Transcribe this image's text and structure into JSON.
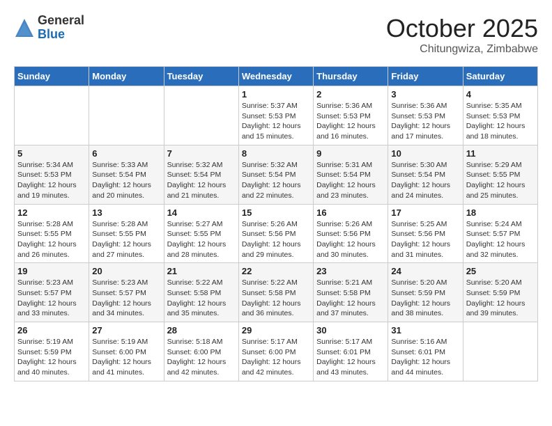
{
  "logo": {
    "general": "General",
    "blue": "Blue"
  },
  "title": "October 2025",
  "subtitle": "Chitungwiza, Zimbabwe",
  "weekdays": [
    "Sunday",
    "Monday",
    "Tuesday",
    "Wednesday",
    "Thursday",
    "Friday",
    "Saturday"
  ],
  "weeks": [
    [
      {
        "day": "",
        "info": ""
      },
      {
        "day": "",
        "info": ""
      },
      {
        "day": "",
        "info": ""
      },
      {
        "day": "1",
        "info": "Sunrise: 5:37 AM\nSunset: 5:53 PM\nDaylight: 12 hours\nand 15 minutes."
      },
      {
        "day": "2",
        "info": "Sunrise: 5:36 AM\nSunset: 5:53 PM\nDaylight: 12 hours\nand 16 minutes."
      },
      {
        "day": "3",
        "info": "Sunrise: 5:36 AM\nSunset: 5:53 PM\nDaylight: 12 hours\nand 17 minutes."
      },
      {
        "day": "4",
        "info": "Sunrise: 5:35 AM\nSunset: 5:53 PM\nDaylight: 12 hours\nand 18 minutes."
      }
    ],
    [
      {
        "day": "5",
        "info": "Sunrise: 5:34 AM\nSunset: 5:53 PM\nDaylight: 12 hours\nand 19 minutes."
      },
      {
        "day": "6",
        "info": "Sunrise: 5:33 AM\nSunset: 5:54 PM\nDaylight: 12 hours\nand 20 minutes."
      },
      {
        "day": "7",
        "info": "Sunrise: 5:32 AM\nSunset: 5:54 PM\nDaylight: 12 hours\nand 21 minutes."
      },
      {
        "day": "8",
        "info": "Sunrise: 5:32 AM\nSunset: 5:54 PM\nDaylight: 12 hours\nand 22 minutes."
      },
      {
        "day": "9",
        "info": "Sunrise: 5:31 AM\nSunset: 5:54 PM\nDaylight: 12 hours\nand 23 minutes."
      },
      {
        "day": "10",
        "info": "Sunrise: 5:30 AM\nSunset: 5:54 PM\nDaylight: 12 hours\nand 24 minutes."
      },
      {
        "day": "11",
        "info": "Sunrise: 5:29 AM\nSunset: 5:55 PM\nDaylight: 12 hours\nand 25 minutes."
      }
    ],
    [
      {
        "day": "12",
        "info": "Sunrise: 5:28 AM\nSunset: 5:55 PM\nDaylight: 12 hours\nand 26 minutes."
      },
      {
        "day": "13",
        "info": "Sunrise: 5:28 AM\nSunset: 5:55 PM\nDaylight: 12 hours\nand 27 minutes."
      },
      {
        "day": "14",
        "info": "Sunrise: 5:27 AM\nSunset: 5:55 PM\nDaylight: 12 hours\nand 28 minutes."
      },
      {
        "day": "15",
        "info": "Sunrise: 5:26 AM\nSunset: 5:56 PM\nDaylight: 12 hours\nand 29 minutes."
      },
      {
        "day": "16",
        "info": "Sunrise: 5:26 AM\nSunset: 5:56 PM\nDaylight: 12 hours\nand 30 minutes."
      },
      {
        "day": "17",
        "info": "Sunrise: 5:25 AM\nSunset: 5:56 PM\nDaylight: 12 hours\nand 31 minutes."
      },
      {
        "day": "18",
        "info": "Sunrise: 5:24 AM\nSunset: 5:57 PM\nDaylight: 12 hours\nand 32 minutes."
      }
    ],
    [
      {
        "day": "19",
        "info": "Sunrise: 5:23 AM\nSunset: 5:57 PM\nDaylight: 12 hours\nand 33 minutes."
      },
      {
        "day": "20",
        "info": "Sunrise: 5:23 AM\nSunset: 5:57 PM\nDaylight: 12 hours\nand 34 minutes."
      },
      {
        "day": "21",
        "info": "Sunrise: 5:22 AM\nSunset: 5:58 PM\nDaylight: 12 hours\nand 35 minutes."
      },
      {
        "day": "22",
        "info": "Sunrise: 5:22 AM\nSunset: 5:58 PM\nDaylight: 12 hours\nand 36 minutes."
      },
      {
        "day": "23",
        "info": "Sunrise: 5:21 AM\nSunset: 5:58 PM\nDaylight: 12 hours\nand 37 minutes."
      },
      {
        "day": "24",
        "info": "Sunrise: 5:20 AM\nSunset: 5:59 PM\nDaylight: 12 hours\nand 38 minutes."
      },
      {
        "day": "25",
        "info": "Sunrise: 5:20 AM\nSunset: 5:59 PM\nDaylight: 12 hours\nand 39 minutes."
      }
    ],
    [
      {
        "day": "26",
        "info": "Sunrise: 5:19 AM\nSunset: 5:59 PM\nDaylight: 12 hours\nand 40 minutes."
      },
      {
        "day": "27",
        "info": "Sunrise: 5:19 AM\nSunset: 6:00 PM\nDaylight: 12 hours\nand 41 minutes."
      },
      {
        "day": "28",
        "info": "Sunrise: 5:18 AM\nSunset: 6:00 PM\nDaylight: 12 hours\nand 42 minutes."
      },
      {
        "day": "29",
        "info": "Sunrise: 5:17 AM\nSunset: 6:00 PM\nDaylight: 12 hours\nand 42 minutes."
      },
      {
        "day": "30",
        "info": "Sunrise: 5:17 AM\nSunset: 6:01 PM\nDaylight: 12 hours\nand 43 minutes."
      },
      {
        "day": "31",
        "info": "Sunrise: 5:16 AM\nSunset: 6:01 PM\nDaylight: 12 hours\nand 44 minutes."
      },
      {
        "day": "",
        "info": ""
      }
    ]
  ]
}
